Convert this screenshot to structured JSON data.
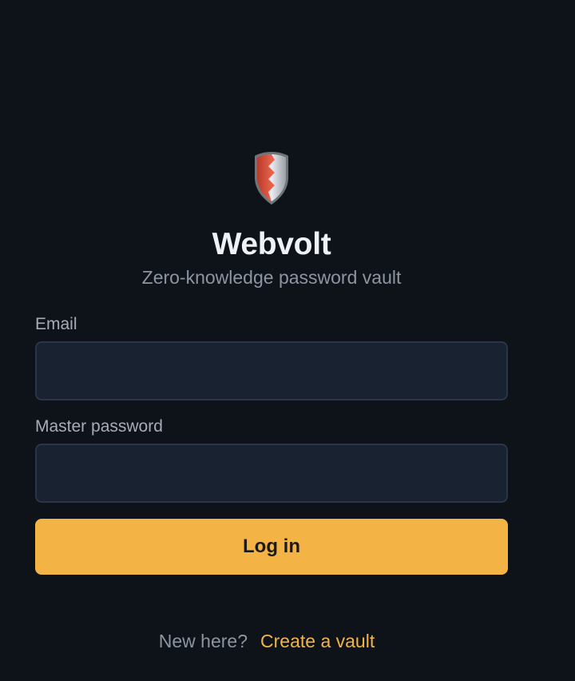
{
  "app": {
    "name": "Webvolt",
    "tagline": "Zero-knowledge password vault",
    "logo_icon": "shield-icon"
  },
  "colors": {
    "background": "#0e131a",
    "field_background": "#182230",
    "field_border": "#29364a",
    "accent": "#f3b445",
    "shield_red": "#e5533d",
    "shield_silver": "#c9ccd2"
  },
  "form": {
    "email_label": "Email",
    "email_value": "",
    "email_placeholder": "",
    "password_label": "Master password",
    "password_value": "",
    "password_placeholder": "",
    "submit_label": "Log in"
  },
  "footer": {
    "prompt": "New here?",
    "link_label": "Create a vault"
  }
}
